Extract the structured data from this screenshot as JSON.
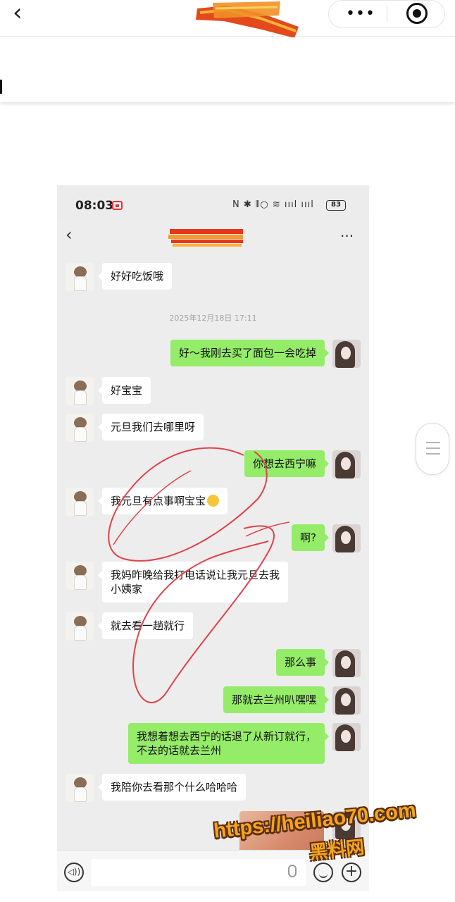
{
  "outer_header": {
    "back_icon": "‹",
    "more_icon": "•••",
    "target_icon": "record-target-icon"
  },
  "status_bar": {
    "time": "08:03",
    "icons": "N ✱ ⫴○ ≋ ıııl ıııl",
    "battery": "83"
  },
  "chat_header": {
    "back_icon": "‹",
    "more_icon": "···"
  },
  "timestamp": "2025年12月18日 17:11",
  "messages": [
    {
      "side": "in",
      "text": "好好吃饭哦"
    },
    {
      "side": "out",
      "text": "好～我刚去买了面包一会吃掉"
    },
    {
      "side": "in",
      "text": "好宝宝"
    },
    {
      "side": "in",
      "text": "元旦我们去哪里呀"
    },
    {
      "side": "out",
      "text": "你想去西宁嘛"
    },
    {
      "side": "in",
      "text": "我元旦有点事啊宝宝"
    },
    {
      "side": "out",
      "text": "啊?"
    },
    {
      "side": "in",
      "text": "我妈昨晚给我打电话说让我元旦去我\n小姨家"
    },
    {
      "side": "in",
      "text": "就去看一趟就行"
    },
    {
      "side": "out",
      "text": "那么事"
    },
    {
      "side": "out",
      "text": "那就去兰州叭嘿嘿"
    },
    {
      "side": "out",
      "text": "我想着想去西宁的话退了从新订就行，\n不去的话就去兰州"
    },
    {
      "side": "in",
      "text": "我陪你去看那个什么哈哈哈"
    }
  ],
  "input_bar": {
    "voice_icon": "◁))",
    "plus_icon": "+"
  },
  "watermark": {
    "url": "https://heiliao70.com",
    "site": "黑料网"
  },
  "colors": {
    "out_bubble": "#95ec69",
    "in_bubble": "#ffffff",
    "chat_bg": "#ededed",
    "annotation": "#e0424a"
  }
}
